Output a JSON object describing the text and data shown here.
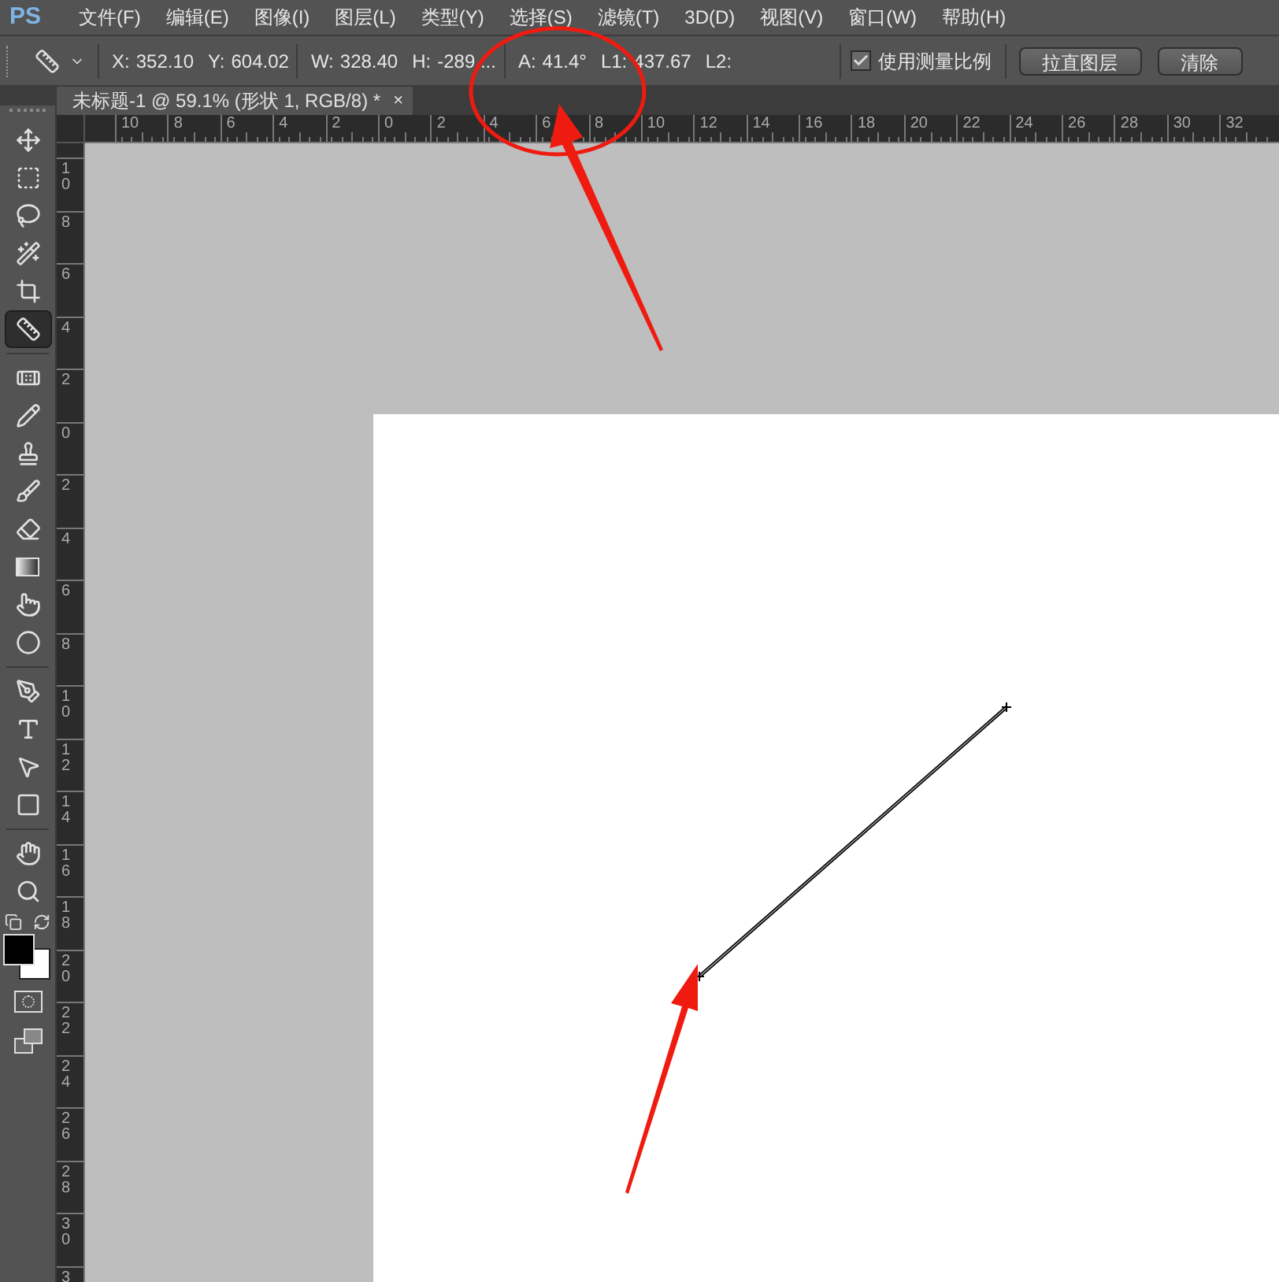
{
  "app": {
    "logo": "PS"
  },
  "menu": [
    "文件(F)",
    "编辑(E)",
    "图像(I)",
    "图层(L)",
    "类型(Y)",
    "选择(S)",
    "滤镜(T)",
    "3D(D)",
    "视图(V)",
    "窗口(W)",
    "帮助(H)"
  ],
  "options_bar": {
    "measurements": [
      {
        "label": "X:",
        "value": "352.10"
      },
      {
        "label": "Y:",
        "value": "604.02"
      },
      {
        "label": "W:",
        "value": "328.40"
      },
      {
        "label": "H:",
        "value": "-289...."
      },
      {
        "label": "A:",
        "value": "41.4°"
      },
      {
        "label": "L1:",
        "value": "437.67"
      },
      {
        "label": "L2:"
      }
    ],
    "use_measurement_scale": {
      "label": "使用测量比例",
      "checked": true
    },
    "buttons": [
      "拉直图层",
      "清除"
    ]
  },
  "document_tab": {
    "title": "未标题-1 @ 59.1% (形状 1, RGB/8) *",
    "close": "×",
    "selected": true
  },
  "tools": [
    {
      "kind": "move",
      "selected": false
    },
    {
      "kind": "marquee",
      "selected": false
    },
    {
      "kind": "lasso",
      "selected": false
    },
    {
      "kind": "wand",
      "selected": false
    },
    {
      "kind": "crop",
      "selected": false
    },
    {
      "kind": "ruler",
      "selected": true
    },
    {
      "kind": "healing",
      "selected": false
    },
    {
      "kind": "brush",
      "selected": false
    },
    {
      "kind": "stamp",
      "selected": false
    },
    {
      "kind": "history",
      "selected": false
    },
    {
      "kind": "eraser",
      "selected": false
    },
    {
      "kind": "gradient",
      "selected": false
    },
    {
      "kind": "smudge",
      "selected": false
    },
    {
      "kind": "dodge",
      "selected": false
    },
    {
      "kind": "pen",
      "selected": false
    },
    {
      "kind": "type",
      "selected": false
    },
    {
      "kind": "path",
      "selected": false
    },
    {
      "kind": "shape",
      "selected": false
    },
    {
      "kind": "hand",
      "selected": false
    },
    {
      "kind": "zoom",
      "selected": false
    }
  ],
  "horizontal_ruler": [
    "10",
    "8",
    "6",
    "4",
    "2",
    "0",
    "2",
    "4",
    "6",
    "8",
    "10",
    "12",
    "14",
    "16",
    "18",
    "20",
    "22",
    "24",
    "26",
    "28",
    "30",
    "32"
  ],
  "vertical_ruler": [
    "10",
    "8",
    "6",
    "4",
    "2",
    "0",
    "2",
    "4",
    "6",
    "8",
    "10",
    "12",
    "14",
    "16",
    "18",
    "20",
    "22",
    "24",
    "26",
    "28",
    "30",
    "3"
  ]
}
